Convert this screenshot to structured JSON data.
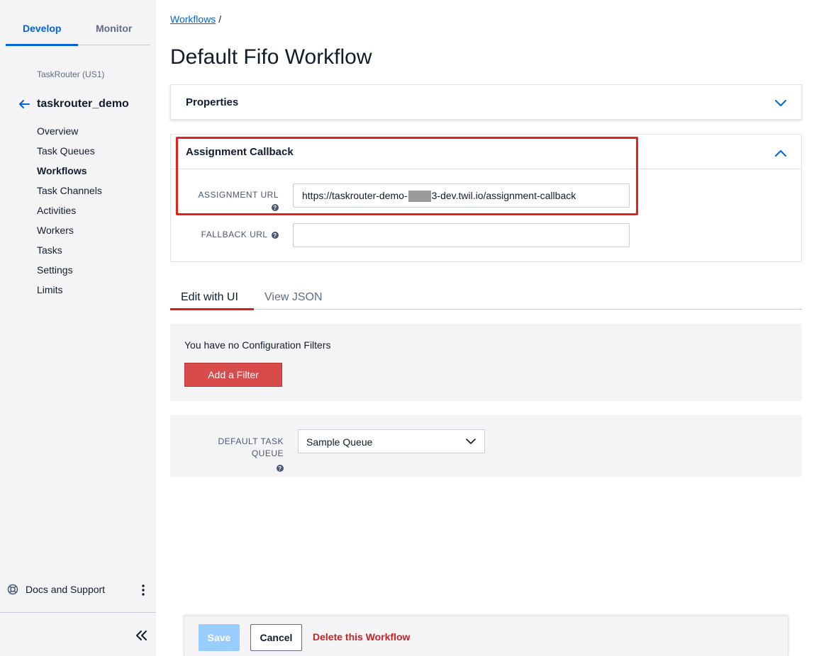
{
  "sidebar": {
    "tabs": [
      {
        "label": "Develop"
      },
      {
        "label": "Monitor"
      }
    ],
    "region": "TaskRouter (US1)",
    "service_name": "taskrouter_demo",
    "items": [
      {
        "label": "Overview"
      },
      {
        "label": "Task Queues"
      },
      {
        "label": "Workflows"
      },
      {
        "label": "Task Channels"
      },
      {
        "label": "Activities"
      },
      {
        "label": "Workers"
      },
      {
        "label": "Tasks"
      },
      {
        "label": "Settings"
      },
      {
        "label": "Limits"
      }
    ],
    "docs_label": "Docs and Support"
  },
  "breadcrumb": {
    "link": "Workflows",
    "separator": "/"
  },
  "page_title": "Default Fifo Workflow",
  "properties": {
    "title": "Properties"
  },
  "assignment": {
    "title": "Assignment Callback",
    "assignment_url_label": "ASSIGNMENT URL",
    "assignment_url_prefix": "https://taskrouter-demo-",
    "assignment_url_suffix": "3-dev.twil.io/assignment-callback",
    "fallback_url_label": "FALLBACK URL",
    "fallback_url_value": ""
  },
  "config_tabs": [
    {
      "label": "Edit with UI"
    },
    {
      "label": "View JSON"
    }
  ],
  "filters": {
    "empty_text": "You have no Configuration Filters",
    "add_button": "Add a Filter"
  },
  "default_queue": {
    "label": "DEFAULT TASK QUEUE",
    "value": "Sample Queue"
  },
  "footer": {
    "save": "Save",
    "cancel": "Cancel",
    "delete": "Delete this Workflow"
  },
  "colors": {
    "accent": "#0263e0",
    "danger": "#d61f1f",
    "highlight": "#e3231b",
    "button_red": "#d84b4b"
  }
}
